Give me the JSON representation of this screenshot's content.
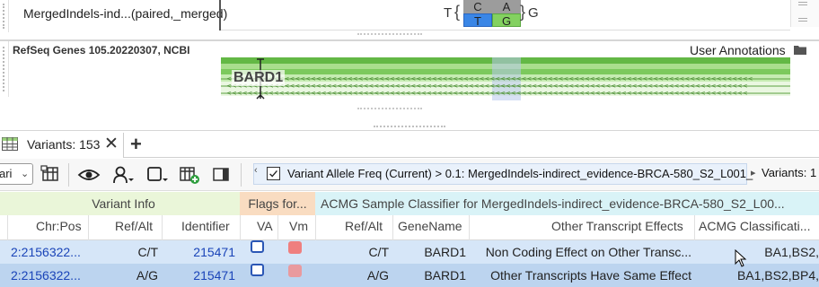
{
  "genome": {
    "track1_label": "MergedIndels-ind...(paired,_merged)",
    "ref_base": "T",
    "alt_base": "G",
    "variants": [
      {
        "ref": "C",
        "alt": "T",
        "alt_color": "#3a7fe0",
        "ref_color": "#9a9a9a"
      },
      {
        "ref": "A",
        "alt": "G",
        "alt_color": "#7fcf5f",
        "ref_color": "#9a9a9a"
      }
    ],
    "track2_label": "RefSeq Genes 105.20220307, NCBI",
    "user_annotations": "User Annotations",
    "gene_name": "BARD1",
    "gene_color": "#7dcc5a"
  },
  "tab": {
    "label": "Variants: 153",
    "close": "✕",
    "add": "+"
  },
  "toolbar": {
    "view_select": "ari",
    "filter_text": "Variant Allele Freq (Current) > 0.1: MergedIndels-indirect_evidence-BRCA-580_S2_L001_",
    "variants_count": "Variants:  1"
  },
  "table": {
    "groups": [
      {
        "label": "Variant Info",
        "color": "#eaf6d9",
        "text_color": "#444"
      },
      {
        "label": "Flags for...",
        "color": "#f9dcc1",
        "text_color": "#444"
      },
      {
        "label": "ACMG Sample Classifier for MergedIndels-indirect_evidence-BRCA-580_S2_L00...",
        "color": "#d9f3f7",
        "text_color": "#444"
      }
    ],
    "columns": [
      "Chr:Pos",
      "Ref/Alt",
      "Identifier",
      "VA",
      "Vm",
      "Ref/Alt",
      "GeneName",
      "Other Transcript Effects",
      "ACMG Classificati..."
    ],
    "rows": [
      {
        "chrpos": "2:2156322...",
        "refalt": "C/T",
        "identifier": "215471",
        "refalt2": "C/T",
        "gene": "BARD1",
        "effects": "Non Coding Effect on Other Transc...",
        "acmg": "BA1,BS2,",
        "bg": "#d6e6f8"
      },
      {
        "chrpos": "2:2156322...",
        "refalt": "A/G",
        "identifier": "215471",
        "refalt2": "A/G",
        "gene": "BARD1",
        "effects": "Other Transcripts Have Same Effect",
        "acmg": "BA1,BS2,BP4,",
        "bg": "#bcd4ef"
      }
    ]
  }
}
